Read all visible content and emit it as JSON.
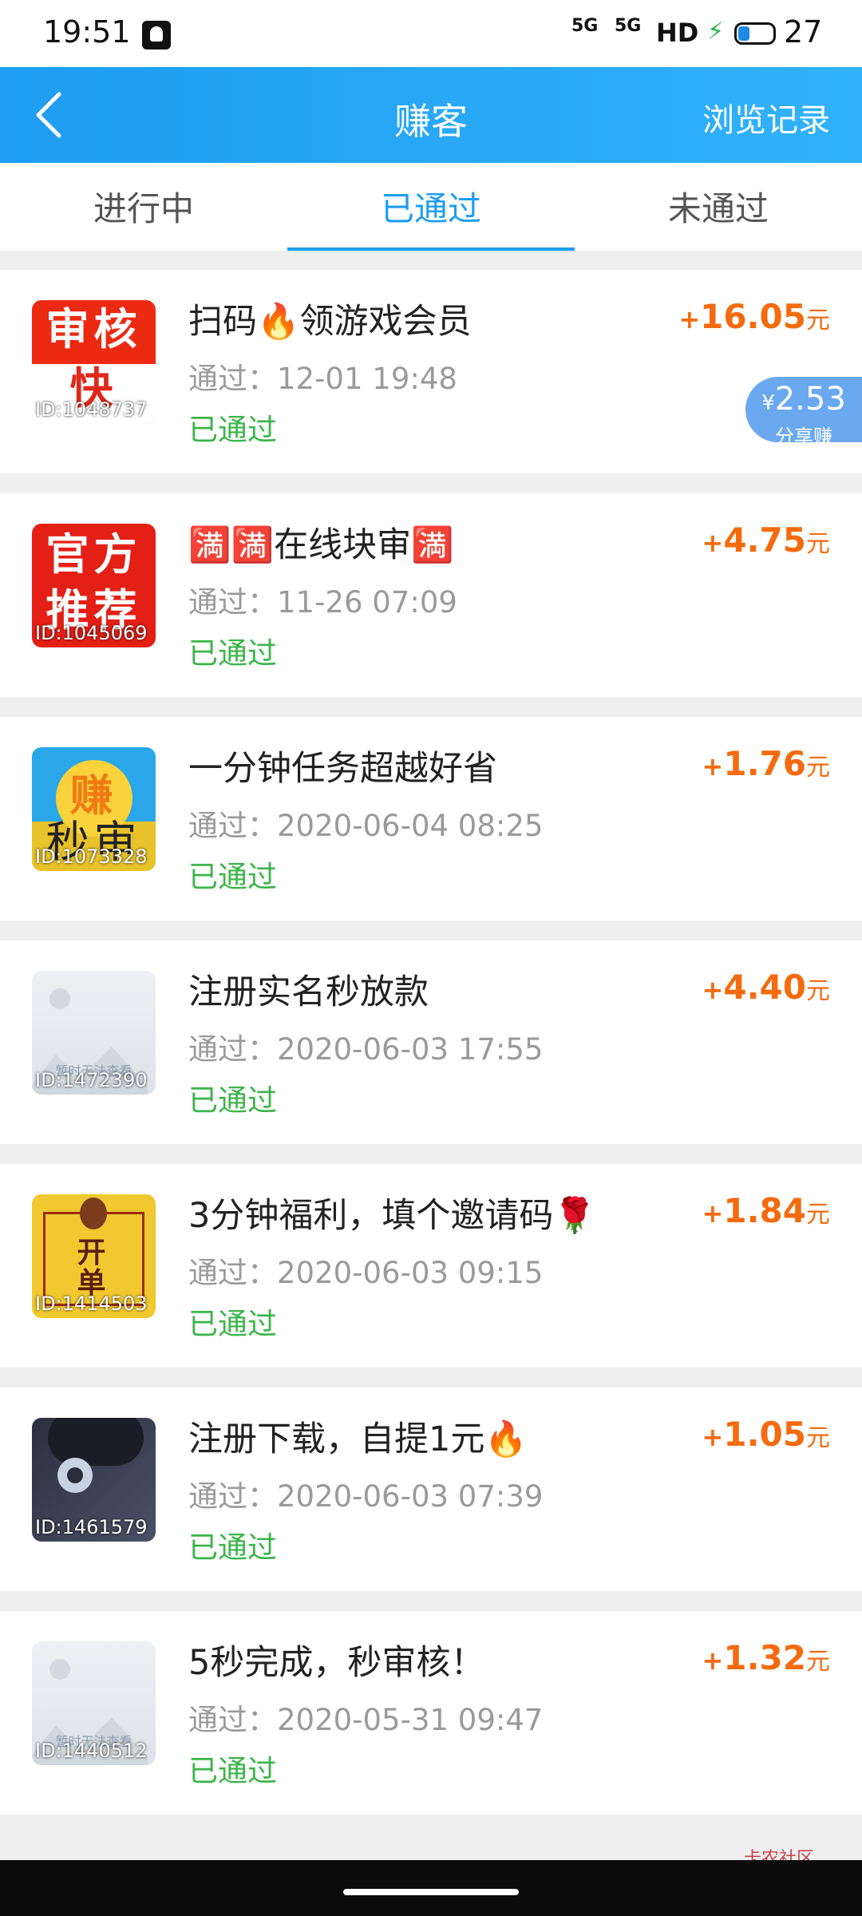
{
  "status_bar": {
    "time": "19:51",
    "signal1": "5G",
    "signal2": "5G",
    "hd": "HD",
    "battery": "27"
  },
  "header": {
    "title": "赚客",
    "history_label": "浏览记录"
  },
  "tabs": [
    {
      "label": "进行中",
      "active": false
    },
    {
      "label": "已通过",
      "active": true
    },
    {
      "label": "未通过",
      "active": false
    }
  ],
  "tasks": [
    {
      "title": "扫码🔥领游戏会员",
      "date": "通过：12-01 19:48",
      "status": "已通过",
      "reward_sign": "+",
      "reward": "16.05",
      "unit": "元",
      "thumb_id": "ID:1048737",
      "thumb_text": [
        "审核",
        "快"
      ],
      "share": {
        "currency": "¥",
        "amount": "2.53",
        "label": "分享赚"
      }
    },
    {
      "title": "🈵🈵在线块审🈵",
      "date": "通过：11-26 07:09",
      "status": "已通过",
      "reward_sign": "+",
      "reward": "4.75",
      "unit": "元",
      "thumb_id": "ID:1045069",
      "thumb_text": [
        "官方",
        "推荐"
      ]
    },
    {
      "title": "一分钟任务超越好省",
      "date": "通过：2020-06-04 08:25",
      "status": "已通过",
      "reward_sign": "+",
      "reward": "1.76",
      "unit": "元",
      "thumb_id": "ID:1073328",
      "thumb_text": [
        "赚",
        "秒审"
      ]
    },
    {
      "title": "注册实名秒放款",
      "date": "通过：2020-06-03 17:55",
      "status": "已通过",
      "reward_sign": "+",
      "reward": "4.40",
      "unit": "元",
      "thumb_id": "ID:1472390",
      "thumb_placeholder": "暂时无法查看"
    },
    {
      "title": "3分钟福利，填个邀请码🌹",
      "date": "通过：2020-06-03 09:15",
      "status": "已通过",
      "reward_sign": "+",
      "reward": "1.84",
      "unit": "元",
      "thumb_id": "ID:1414503",
      "thumb_text": [
        "开",
        "单"
      ]
    },
    {
      "title": "注册下载，自提1元🔥",
      "date": "通过：2020-06-03 07:39",
      "status": "已通过",
      "reward_sign": "+",
      "reward": "1.05",
      "unit": "元",
      "thumb_id": "ID:1461579"
    },
    {
      "title": "5秒完成，秒审核！",
      "date": "通过：2020-05-31 09:47",
      "status": "已通过",
      "reward_sign": "+",
      "reward": "1.32",
      "unit": "元",
      "thumb_id": "ID:1440512",
      "thumb_placeholder": "暂时无法查看"
    }
  ],
  "watermark": "卡农社区",
  "colors": {
    "header_blue": "#1e9df2",
    "reward_orange": "#f46b0f",
    "status_green": "#3bb54a",
    "share_blue": "#6aa9f0"
  }
}
